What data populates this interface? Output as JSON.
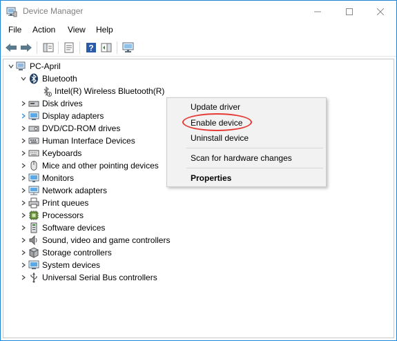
{
  "window": {
    "title": "Device Manager",
    "controls": {
      "minimize": "minimize",
      "maximize": "maximize",
      "close": "close"
    }
  },
  "menu": [
    "File",
    "Action",
    "View",
    "Help"
  ],
  "toolbar": {
    "buttons": [
      "back-icon",
      "forward-icon",
      "show-hide-console-tree-icon",
      "properties-icon",
      "help-icon",
      "action-pane-icon",
      "scan-hardware-icon"
    ]
  },
  "tree": {
    "root": "PC-April",
    "expanded_category": "Bluetooth",
    "selected_device": "Intel(R) Wireless Bluetooth(R)",
    "categories": [
      "Disk drives",
      "Display adapters",
      "DVD/CD-ROM drives",
      "Human Interface Devices",
      "Keyboards",
      "Mice and other pointing devices",
      "Monitors",
      "Network adapters",
      "Print queues",
      "Processors",
      "Software devices",
      "Sound, video and game controllers",
      "Storage controllers",
      "System devices",
      "Universal Serial Bus controllers"
    ]
  },
  "context_menu": {
    "items": [
      "Update driver",
      "Enable device",
      "Uninstall device",
      "Scan for hardware changes",
      "Properties"
    ],
    "highlighted": "Enable device",
    "default_item": "Properties"
  },
  "colors": {
    "window_border": "#1883d7",
    "highlight_ring": "#e53935",
    "menu_background": "#f2f2f2"
  }
}
